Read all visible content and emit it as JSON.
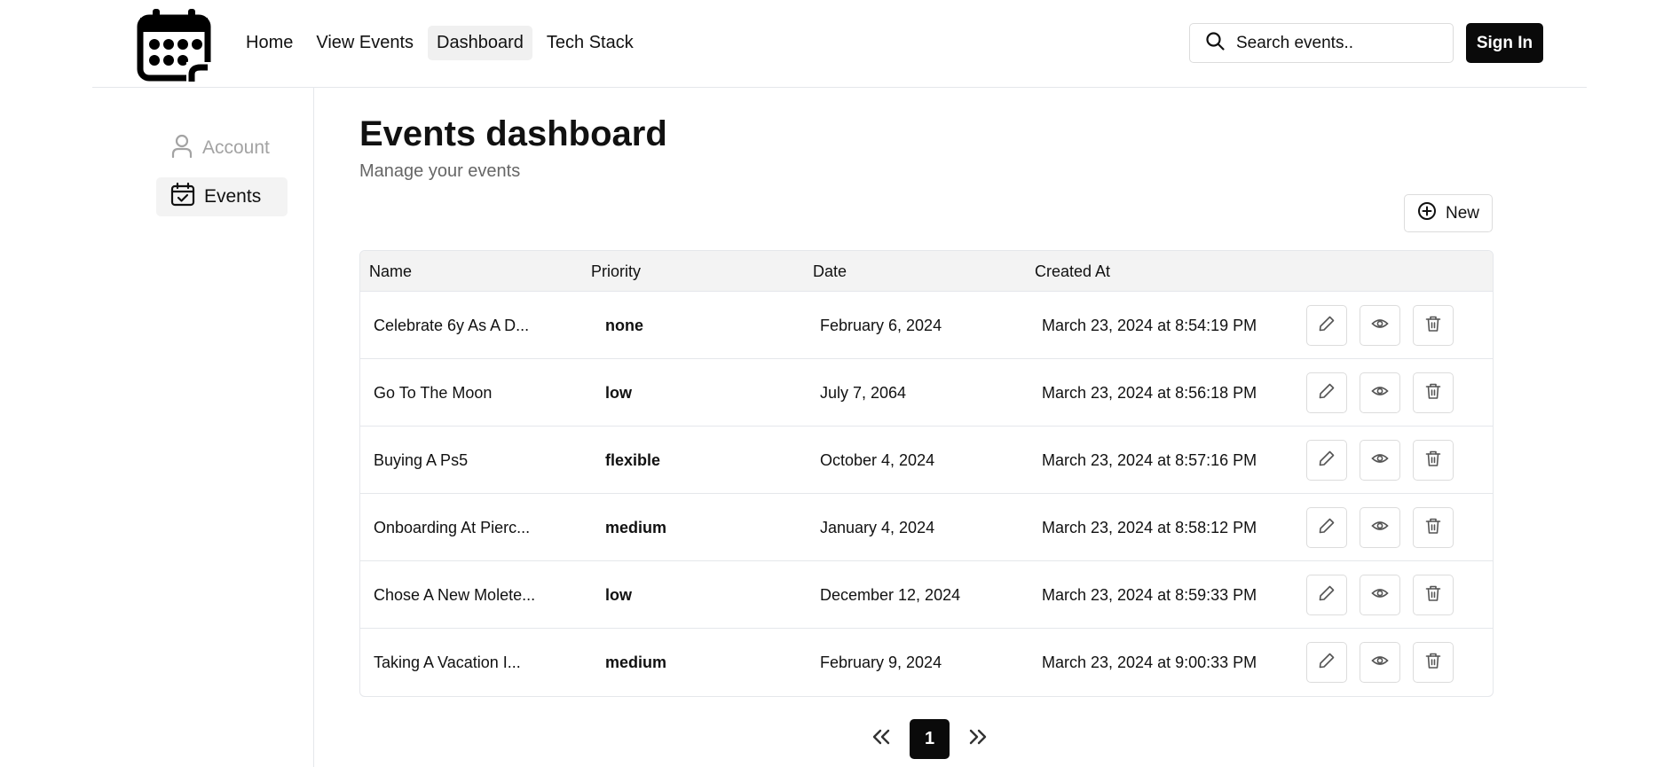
{
  "nav": {
    "items": [
      {
        "label": "Home",
        "active": false
      },
      {
        "label": "View Events",
        "active": false
      },
      {
        "label": "Dashboard",
        "active": true
      },
      {
        "label": "Tech Stack",
        "active": false
      }
    ],
    "search_placeholder": "Search events..",
    "signin_label": "Sign In"
  },
  "sidebar": {
    "items": [
      {
        "label": "Account",
        "icon": "user-icon",
        "active": false
      },
      {
        "label": "Events",
        "icon": "calendar-check-icon",
        "active": true
      }
    ]
  },
  "main": {
    "title": "Events dashboard",
    "subtitle": "Manage your events",
    "new_label": "New"
  },
  "table": {
    "columns": [
      "Name",
      "Priority",
      "Date",
      "Created At"
    ],
    "rows": [
      {
        "name": "Celebrate 6y As A D...",
        "priority": "none",
        "date": "February 6, 2024",
        "created": "March 23, 2024 at 8:54:19 PM"
      },
      {
        "name": "Go To The Moon",
        "priority": "low",
        "date": "July 7, 2064",
        "created": "March 23, 2024 at 8:56:18 PM"
      },
      {
        "name": "Buying A Ps5",
        "priority": "flexible",
        "date": "October 4, 2024",
        "created": "March 23, 2024 at 8:57:16 PM"
      },
      {
        "name": "Onboarding At Pierc...",
        "priority": "medium",
        "date": "January 4, 2024",
        "created": "March 23, 2024 at 8:58:12 PM"
      },
      {
        "name": "Chose A New Molete...",
        "priority": "low",
        "date": "December 12, 2024",
        "created": "March 23, 2024 at 8:59:33 PM"
      },
      {
        "name": "Taking A Vacation I...",
        "priority": "medium",
        "date": "February 9, 2024",
        "created": "March 23, 2024 at 9:00:33 PM"
      }
    ]
  },
  "pagination": {
    "current_page": "1"
  },
  "colors": {
    "primary": "#0a0a0a",
    "border": "#e5e7eb",
    "muted_text": "#a3a3a3",
    "active_bg": "#f3f3f3"
  }
}
